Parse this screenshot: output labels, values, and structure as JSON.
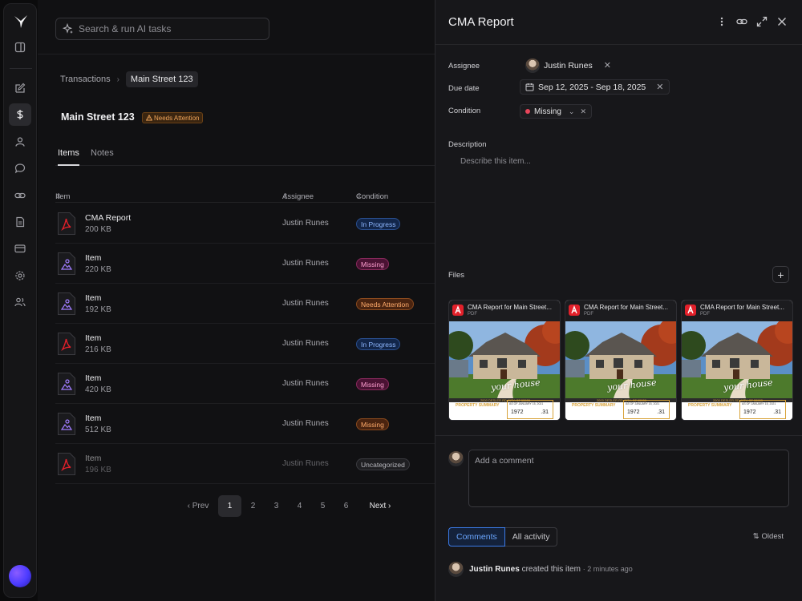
{
  "search": {
    "placeholder": "Search & run AI tasks"
  },
  "breadcrumb": {
    "parent": "Transactions",
    "current": "Main Street 123"
  },
  "page": {
    "title": "Main Street 123",
    "badge": "Needs Attention"
  },
  "tabs": [
    "Items",
    "Notes"
  ],
  "table": {
    "columns": [
      "Item",
      "Assignee",
      "Condition"
    ],
    "rows": [
      {
        "name": "CMA Report",
        "size": "200 KB",
        "assignee": "Justin Runes",
        "condition": "In Progress",
        "icon": "pdf-file-icon",
        "style": "prog"
      },
      {
        "name": "Item",
        "size": "220 KB",
        "assignee": "Justin Runes",
        "condition": "Missing",
        "icon": "image-file-icon",
        "style": "miss"
      },
      {
        "name": "Item",
        "size": "192 KB",
        "assignee": "Justin Runes",
        "condition": "Needs Attention",
        "icon": "image-file-icon",
        "style": "attn"
      },
      {
        "name": "Item",
        "size": "216 KB",
        "assignee": "Justin Runes",
        "condition": "In Progress",
        "icon": "pdf-file-icon",
        "style": "prog"
      },
      {
        "name": "Item",
        "size": "420 KB",
        "assignee": "Justin Runes",
        "condition": "Missing",
        "icon": "image-file-icon",
        "style": "miss"
      },
      {
        "name": "Item",
        "size": "512 KB",
        "assignee": "Justin Runes",
        "condition": "Missing",
        "icon": "image-file-icon",
        "style": "attn"
      },
      {
        "name": "Item",
        "size": "196 KB",
        "assignee": "Justin Runes",
        "condition": "Uncategorized",
        "icon": "pdf-file-icon",
        "style": "unc"
      }
    ]
  },
  "pagination": {
    "prev": "Prev",
    "next": "Next",
    "pages": [
      "1",
      "2",
      "3",
      "4",
      "5",
      "6"
    ],
    "current": "1"
  },
  "panel": {
    "title": "CMA Report",
    "assignee_label": "Assignee",
    "assignee": "Justin Runes",
    "due_label": "Due date",
    "due": "Sep 12, 2025 - Sep 18, 2025",
    "condition_label": "Condition",
    "condition": "Missing",
    "description_label": "Description",
    "description_placeholder": "Describe this item...",
    "files_label": "Files",
    "files": [
      {
        "title": "CMA Report for Main Street...",
        "type": "PDF"
      },
      {
        "title": "CMA Report for Main Street...",
        "type": "PDF"
      },
      {
        "title": "CMA Report for Main Street...",
        "type": "PDF"
      }
    ],
    "file_preview": {
      "script": "your house",
      "address": "2000 DESLER RD CITY, ST 55555",
      "summary": "PROPERTY SUMMARY",
      "date": "AS OF JANUARY 15, 2021",
      "year": "1972",
      "acre": ".31"
    },
    "comment_placeholder": "Add a comment",
    "comment_tabs": [
      "Comments",
      "All activity"
    ],
    "sort": "Oldest",
    "activity": {
      "user": "Justin Runes",
      "action": "created this item",
      "time": "· 2 minutes ago"
    }
  },
  "colors": {
    "accent": "#3b7be8",
    "missing": "#e8455a",
    "attention": "#f0a55a"
  }
}
